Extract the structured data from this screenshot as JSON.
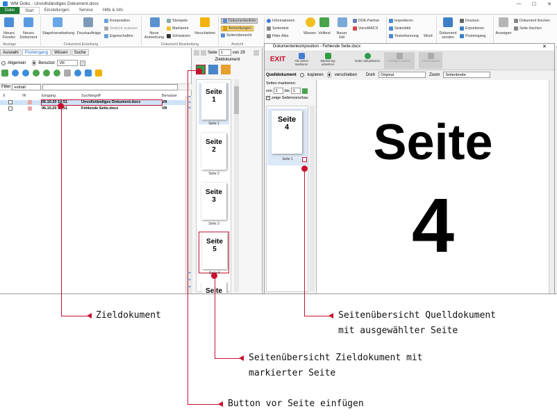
{
  "window": {
    "title": "WM Doku - Unvollständiges Dokument.docx"
  },
  "tabs": [
    "Datei",
    "Start",
    "Einstellungen",
    "Service",
    "Hilfe & Info"
  ],
  "ribbon": {
    "neues_fenster": "Neues Fenster",
    "neues_dokument": "Neues Dokument",
    "stapel": "Stapelverarbeitung",
    "druck": "Druckaufträge",
    "komposition": "Komposition",
    "seite_scannen": "Seite(n) scannen",
    "eigenschaften": "Eigenschaften",
    "neue_anmerkung": "Neue Anmerkung",
    "stempeln": "Stempeln",
    "markieren": "Markieren",
    "schwaerzen": "Schwärzen",
    "verschieben": "Verschieben",
    "dokumentenliste": "Dokumentenliste",
    "anmerkungen": "Anmerkungen",
    "seitenuebersicht": "Seitenübersicht",
    "informationen": "Informationen",
    "seitentext": "Seitentext",
    "filter_akte": "Filter Akte",
    "wissen": "Wissen",
    "volltext": "Volltext",
    "neuer_job": "Neuer Job",
    "dde": "DDE-Partner",
    "voicemacs": "VoiceMACS",
    "importieren": "Importieren",
    "seitenbild": "Seitenbild",
    "texterkennung": "Texterkennung",
    "word": "Word",
    "dok_senden": "Dokument senden",
    "drucken": "Drucken",
    "exportieren": "Exportieren",
    "posteingang": "Posteingang",
    "anzeigen": "Anzeigen",
    "dok_loeschen": "Dokument löschen",
    "seite_loeschen": "Seite löschen",
    "grp_anzeige": "Anzeige",
    "grp_erstellung": "Dokument Erstellung",
    "grp_bearbeitung": "Dokument Bearbeitung",
    "grp_ansicht": "Ansicht"
  },
  "left": {
    "tabs": [
      "Auswahl",
      "Posteingang",
      "Wissen",
      "Suche"
    ],
    "allgemein": "Allgemein",
    "benutzer": "Benutzer",
    "benutzer_value": "VR",
    "filter_label": "Filter",
    "filter_value": "enthält",
    "columns": [
      "X",
      "!R",
      "Eingang",
      "Suchbegriff",
      "Benutzer"
    ],
    "rows": [
      {
        "eingang": "06.10.20 10:51",
        "suchbegriff": "Unvollständiges Dokument.docx",
        "benutzer": "VR"
      },
      {
        "eingang": "06.10.20 10:51",
        "suchbegriff": "Fehlende Seite.docx",
        "benutzer": "VR"
      }
    ]
  },
  "nav": {
    "seite_label": "Seite",
    "seite_value": "1",
    "von": "von 29",
    "zieldokument": "Zieldokument"
  },
  "target_pages": [
    {
      "label": "Seite\n1",
      "cap": "Seite 1"
    },
    {
      "label": "Seite\n2",
      "cap": "Seite 2"
    },
    {
      "label": "Seite\n3",
      "cap": "Seite 3"
    },
    {
      "label": "Seite\n5",
      "cap": "Seite 4"
    },
    {
      "label": "Seite",
      "cap": ""
    }
  ],
  "dialog": {
    "title": "Dokumentenkomposition - Fehlende Seite.docx",
    "exit": "EXIT",
    "tb1": "Alle Seiten markieren",
    "tb2": "Markierung umkehren",
    "tb3": "Seiten aktualisieren",
    "tb4": "Einfügen Ansicht",
    "tb5": "Ausschneiden",
    "quelldokument": "Quelldokument",
    "kopieren": "kopieren",
    "verschieben": "verschieben",
    "dreh": "Dreh",
    "dreh_value": "Original",
    "zoom": "Zoom",
    "zoom_value": "Seitenbreite",
    "seiten_markieren": "Seiten markieren:",
    "von": "von",
    "von_value": "1",
    "bis": "bis",
    "bis_value": "1",
    "zeige": "zeige Seitenvorschau",
    "src_page": "Seite\n4",
    "src_cap": "Seite 1",
    "preview_line1": "Seite",
    "preview_line2": "4"
  },
  "annotations": {
    "zieldokument": "Zieldokument",
    "quell": "Seitenübersicht Quelldokument\nmit ausgewählter Seite",
    "ziel": "Seitenübersicht Zieldokument mit\nmarkierter Seite",
    "button": "Button vor Seite einfügen"
  }
}
